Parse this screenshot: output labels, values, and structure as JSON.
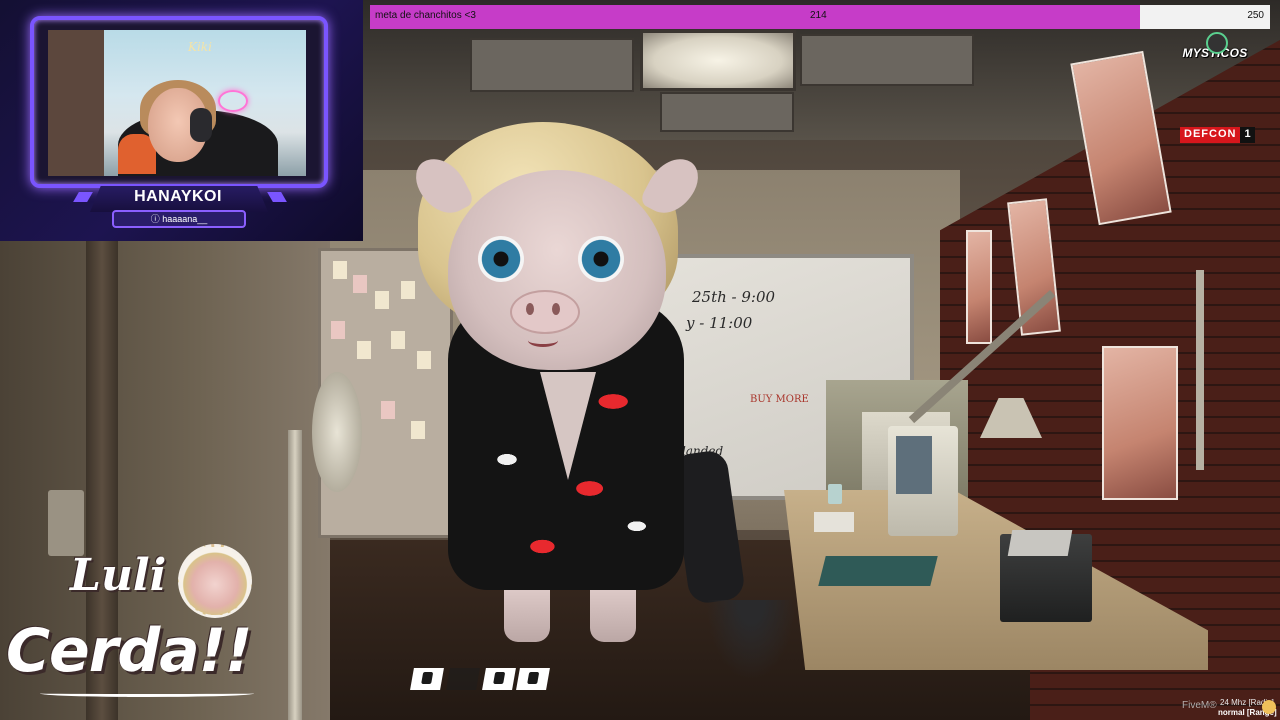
{
  "goal": {
    "label": "meta de chanchitos <3",
    "current": 214,
    "current_text": "214",
    "max_text": "250",
    "progress": 0.856,
    "fill_color": "#c63cc8"
  },
  "webcam": {
    "streamer_name": "HANAYKOI",
    "handle": "ⓘ haaaana__",
    "neon_sign": "Kiki",
    "frame_color": "#7a55ff"
  },
  "brand": {
    "logo_text": "MYSTICOS",
    "emblem_icon": "skull-icon"
  },
  "status": {
    "defcon_label": "DEFCON",
    "defcon_level": "1",
    "defcon_color": "#d7161c"
  },
  "whiteboard": {
    "line1": "25th - 9:00",
    "line2": "y - 11:00",
    "line3": "BUY MORE",
    "line4": "landed"
  },
  "hotbar": {
    "slots": [
      {
        "icon": "envelope-icon",
        "filled": true
      },
      {
        "icon": "",
        "filled": false
      },
      {
        "icon": "hat-icon",
        "filled": true
      },
      {
        "icon": "item-icon",
        "filled": true
      }
    ]
  },
  "overlay": {
    "title_top": "Luli",
    "title_bottom": "Cerda!!"
  },
  "corner": {
    "client": "FiveM®",
    "frequency": "24 Mhz [Radio]",
    "voice_mode": "normal [Range]"
  }
}
